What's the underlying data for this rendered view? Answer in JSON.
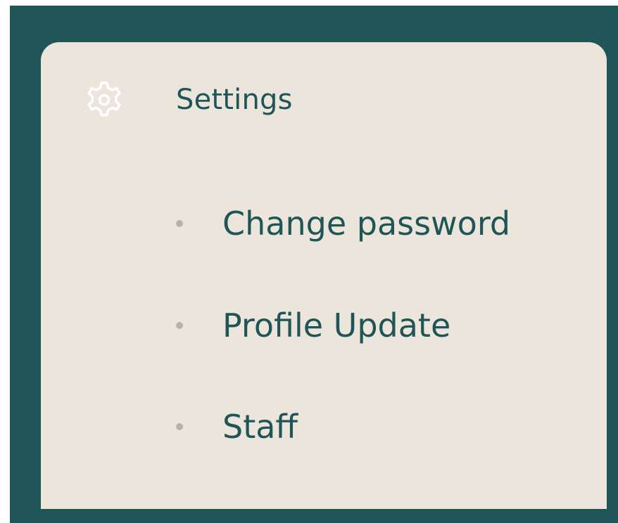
{
  "menu": {
    "header": {
      "label": "Settings",
      "icon": "gear-icon"
    },
    "items": [
      {
        "label": "Change password"
      },
      {
        "label": "Profile Update"
      },
      {
        "label": "Staff"
      }
    ]
  },
  "colors": {
    "frame": "#1f5556",
    "panel": "#ebe5db",
    "text": "#1f5556",
    "icon": "#ffffff",
    "bullet": "#b7b3ac"
  }
}
